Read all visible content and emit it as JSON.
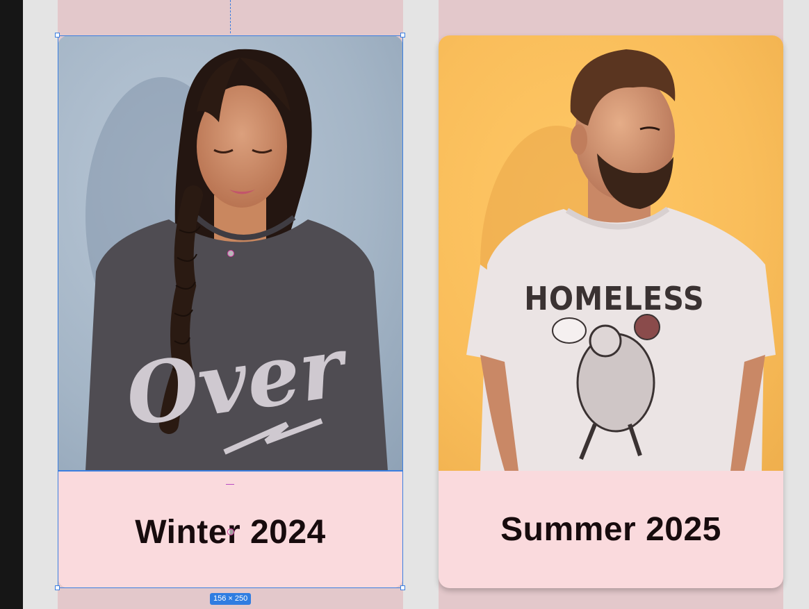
{
  "cards": [
    {
      "title": "Winter 2024",
      "image_subject": "woman in grey Over sweatshirt",
      "shirt_text": "Over"
    },
    {
      "title": "Summer 2025",
      "image_subject": "man in white Homeless t-shirt",
      "shirt_text": "HOMELESS"
    }
  ],
  "selection": {
    "size_label": "156 × 250"
  },
  "colors": {
    "card_bg": "#fadadd",
    "column_bg": "#e3c8cb",
    "canvas_bg": "#e4e4e4",
    "selection": "#3a7ee0",
    "title_text": "#170b0d"
  }
}
